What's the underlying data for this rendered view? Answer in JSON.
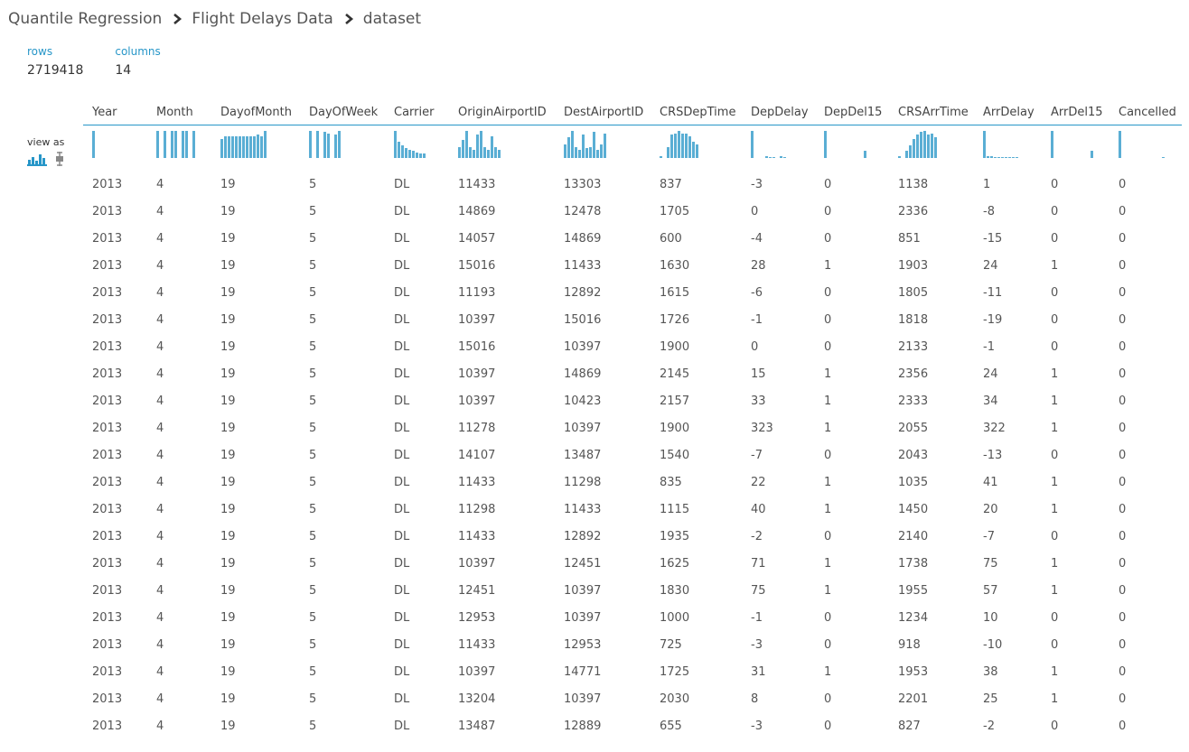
{
  "breadcrumb": {
    "items": [
      "Quantile Regression",
      "Flight Delays Data",
      "dataset"
    ]
  },
  "stats": {
    "rows_label": "rows",
    "rows_value": "2719418",
    "columns_label": "columns",
    "columns_value": "14"
  },
  "view_as": {
    "label": "view as",
    "icons": [
      "histogram-icon",
      "boxplot-icon"
    ]
  },
  "colors": {
    "accent": "#2796c8",
    "bar": "#5aaed4"
  },
  "table": {
    "columns": [
      "Year",
      "Month",
      "DayofMonth",
      "DayOfWeek",
      "Carrier",
      "OriginAirportID",
      "DestAirportID",
      "CRSDepTime",
      "DepDelay",
      "DepDel15",
      "CRSArrTime",
      "ArrDelay",
      "ArrDel15",
      "Cancelled"
    ],
    "histograms": [
      [
        1
      ],
      [
        1,
        0,
        1,
        0,
        1,
        1,
        0,
        1,
        1,
        0,
        1
      ],
      [
        0.7,
        0.8,
        0.8,
        0.8,
        0.8,
        0.8,
        0.8,
        0.8,
        0.8,
        0.8,
        0.85,
        0.8,
        1
      ],
      [
        1,
        0,
        1,
        0,
        0.95,
        0.9,
        0,
        0.85,
        1
      ],
      [
        1,
        0.6,
        0.45,
        0.35,
        0.3,
        0.25,
        0.2,
        0.15,
        0.15
      ],
      [
        0.4,
        0.65,
        1,
        0.4,
        0.3,
        0.85,
        1,
        0.4,
        0.3,
        0.8,
        0.4,
        0.3
      ],
      [
        0.5,
        0.75,
        1,
        0.4,
        0.3,
        0.85,
        0.35,
        0.4,
        0.95,
        0.3,
        0.5,
        0.9
      ],
      [
        0.05,
        0,
        0.4,
        0.85,
        0.9,
        1,
        0.9,
        0.9,
        0.8,
        0.6,
        0.5
      ],
      [
        1,
        0,
        0,
        0,
        0.06,
        0.04,
        0.03,
        0,
        0.05,
        0.04
      ],
      [
        1,
        0,
        0,
        0,
        0,
        0,
        0,
        0,
        0,
        0,
        0,
        0.25
      ],
      [
        0.06,
        0,
        0.25,
        0.45,
        0.7,
        0.85,
        0.95,
        1,
        0.85,
        0.9,
        0.75
      ],
      [
        1,
        0.08,
        0.05,
        0.04,
        0.04,
        0.03,
        0.03,
        0.03,
        0.03,
        0.03
      ],
      [
        1,
        0,
        0,
        0,
        0,
        0,
        0,
        0,
        0,
        0,
        0,
        0.27
      ],
      [
        1,
        0,
        0,
        0,
        0,
        0,
        0,
        0,
        0,
        0,
        0,
        0,
        0.04
      ]
    ],
    "rows": [
      [
        "2013",
        "4",
        "19",
        "5",
        "DL",
        "11433",
        "13303",
        "837",
        "-3",
        "0",
        "1138",
        "1",
        "0",
        "0"
      ],
      [
        "2013",
        "4",
        "19",
        "5",
        "DL",
        "14869",
        "12478",
        "1705",
        "0",
        "0",
        "2336",
        "-8",
        "0",
        "0"
      ],
      [
        "2013",
        "4",
        "19",
        "5",
        "DL",
        "14057",
        "14869",
        "600",
        "-4",
        "0",
        "851",
        "-15",
        "0",
        "0"
      ],
      [
        "2013",
        "4",
        "19",
        "5",
        "DL",
        "15016",
        "11433",
        "1630",
        "28",
        "1",
        "1903",
        "24",
        "1",
        "0"
      ],
      [
        "2013",
        "4",
        "19",
        "5",
        "DL",
        "11193",
        "12892",
        "1615",
        "-6",
        "0",
        "1805",
        "-11",
        "0",
        "0"
      ],
      [
        "2013",
        "4",
        "19",
        "5",
        "DL",
        "10397",
        "15016",
        "1726",
        "-1",
        "0",
        "1818",
        "-19",
        "0",
        "0"
      ],
      [
        "2013",
        "4",
        "19",
        "5",
        "DL",
        "15016",
        "10397",
        "1900",
        "0",
        "0",
        "2133",
        "-1",
        "0",
        "0"
      ],
      [
        "2013",
        "4",
        "19",
        "5",
        "DL",
        "10397",
        "14869",
        "2145",
        "15",
        "1",
        "2356",
        "24",
        "1",
        "0"
      ],
      [
        "2013",
        "4",
        "19",
        "5",
        "DL",
        "10397",
        "10423",
        "2157",
        "33",
        "1",
        "2333",
        "34",
        "1",
        "0"
      ],
      [
        "2013",
        "4",
        "19",
        "5",
        "DL",
        "11278",
        "10397",
        "1900",
        "323",
        "1",
        "2055",
        "322",
        "1",
        "0"
      ],
      [
        "2013",
        "4",
        "19",
        "5",
        "DL",
        "14107",
        "13487",
        "1540",
        "-7",
        "0",
        "2043",
        "-13",
        "0",
        "0"
      ],
      [
        "2013",
        "4",
        "19",
        "5",
        "DL",
        "11433",
        "11298",
        "835",
        "22",
        "1",
        "1035",
        "41",
        "1",
        "0"
      ],
      [
        "2013",
        "4",
        "19",
        "5",
        "DL",
        "11298",
        "11433",
        "1115",
        "40",
        "1",
        "1450",
        "20",
        "1",
        "0"
      ],
      [
        "2013",
        "4",
        "19",
        "5",
        "DL",
        "11433",
        "12892",
        "1935",
        "-2",
        "0",
        "2140",
        "-7",
        "0",
        "0"
      ],
      [
        "2013",
        "4",
        "19",
        "5",
        "DL",
        "10397",
        "12451",
        "1625",
        "71",
        "1",
        "1738",
        "75",
        "1",
        "0"
      ],
      [
        "2013",
        "4",
        "19",
        "5",
        "DL",
        "12451",
        "10397",
        "1830",
        "75",
        "1",
        "1955",
        "57",
        "1",
        "0"
      ],
      [
        "2013",
        "4",
        "19",
        "5",
        "DL",
        "12953",
        "10397",
        "1000",
        "-1",
        "0",
        "1234",
        "10",
        "0",
        "0"
      ],
      [
        "2013",
        "4",
        "19",
        "5",
        "DL",
        "11433",
        "12953",
        "725",
        "-3",
        "0",
        "918",
        "-10",
        "0",
        "0"
      ],
      [
        "2013",
        "4",
        "19",
        "5",
        "DL",
        "10397",
        "14771",
        "1725",
        "31",
        "1",
        "1953",
        "38",
        "1",
        "0"
      ],
      [
        "2013",
        "4",
        "19",
        "5",
        "DL",
        "13204",
        "10397",
        "2030",
        "8",
        "0",
        "2201",
        "25",
        "1",
        "0"
      ],
      [
        "2013",
        "4",
        "19",
        "5",
        "DL",
        "13487",
        "12889",
        "655",
        "-3",
        "0",
        "827",
        "-2",
        "0",
        "0"
      ]
    ]
  }
}
